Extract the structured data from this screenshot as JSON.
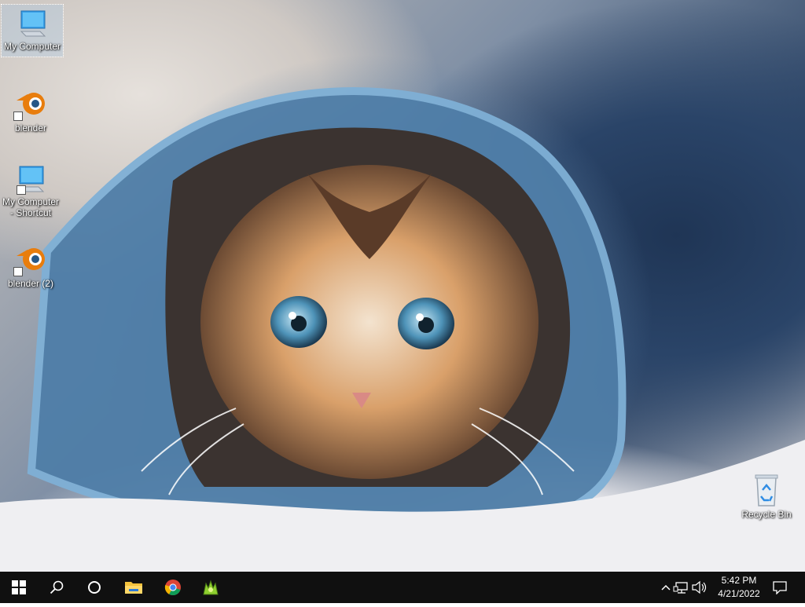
{
  "desktop": {
    "icons": [
      {
        "label": "My Computer",
        "icon": "monitor-icon"
      },
      {
        "label": "blender",
        "icon": "blender-icon"
      },
      {
        "label": "My Computer - Shortcut",
        "icon": "monitor-icon"
      },
      {
        "label": "blender (2)",
        "icon": "blender-icon"
      },
      {
        "label": "Recycle Bin",
        "icon": "recycle-bin-icon"
      }
    ]
  },
  "taskbar": {
    "pinned": [
      {
        "name": "start",
        "icon": "windows-logo-icon"
      },
      {
        "name": "search",
        "icon": "search-icon"
      },
      {
        "name": "task-view",
        "icon": "cortana-circle-icon"
      },
      {
        "name": "file-explorer",
        "icon": "folder-icon"
      },
      {
        "name": "chrome",
        "icon": "chrome-icon"
      },
      {
        "name": "app",
        "icon": "green-app-icon"
      }
    ],
    "tray": {
      "overflow_icon": "chevron-up-icon",
      "network_icon": "network-icon",
      "volume_icon": "speaker-icon",
      "time": "5:42 PM",
      "date": "4/21/2022",
      "notifications_icon": "action-center-icon"
    }
  },
  "colors": {
    "taskbar": "#101010",
    "blender_orange": "#e87d0d",
    "monitor_blue": "#3aa0e8"
  }
}
